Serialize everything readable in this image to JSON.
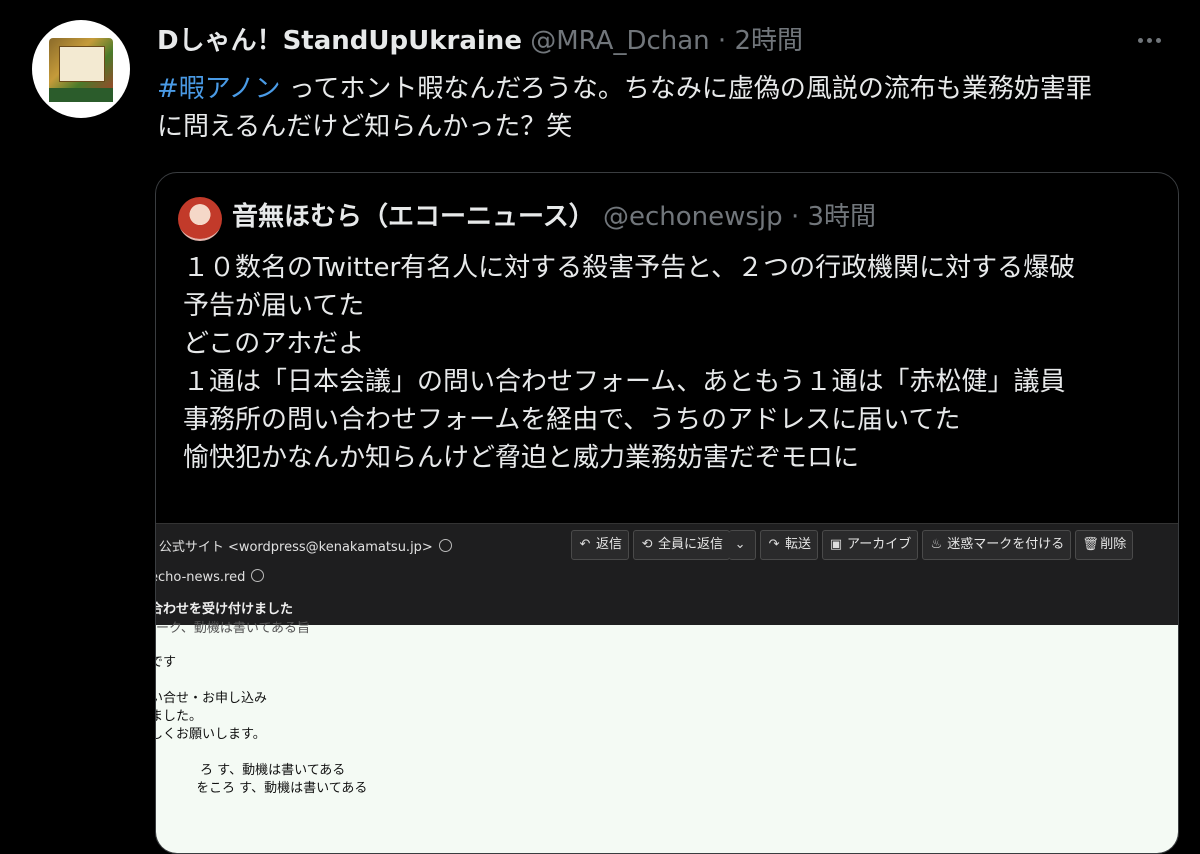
{
  "tweet": {
    "author_name": "Dしゃん！StandUpUkraine",
    "handle": "@MRA_Dchan",
    "separator": "·",
    "time": "2時間",
    "hashtag": "#暇アノン",
    "text_line1": " ってホント暇なんだろうな。ちなみに虚偽の風説の流布も業務妨害罪",
    "text_line2": "に問えるんだけど知らんかった？笑"
  },
  "quote": {
    "author_name": "音無ほむら（エコーニュース）",
    "handle": "@echonewsjp",
    "separator": "·",
    "time": "3時間",
    "lines": [
      "１０数名のTwitter有名人に対する殺害予告と、２つの行政機関に対する爆破",
      "予告が届いてた",
      "どこのアホだよ",
      "１通は「日本会議」の問い合わせフォーム、あともう１通は「赤松健」議員",
      "事務所の問い合わせフォームを経由で、うちのアドレスに届いてた",
      "愉快犯かなんか知らんけど脅迫と威力業務妨害だぞモロに"
    ]
  },
  "email": {
    "sender": "- 公式サイト <wordpress@kenakamatsu.jp>",
    "to": "echo-news.red",
    "subject": "合わせを受け付けました",
    "buttons": {
      "reply": "返信",
      "reply_all": "全員に返信",
      "forward": "転送",
      "archive": "アーカイブ",
      "spam": "迷惑マークを付ける",
      "delete": "削除"
    },
    "body_lines": [
      "ーク、動機は書いてある旨",
      "です",
      "い合せ・お申し込み",
      "ました。",
      "しくお願いします。",
      "ろ す、動機は書いてある",
      "をころ す、動機は書いてある"
    ]
  },
  "icons": {
    "more": "more-horizontal-icon",
    "reply": "reply-arrow-icon",
    "reply_all": "reply-all-icon",
    "forward": "forward-arrow-icon",
    "archive": "archive-box-icon",
    "spam": "flame-icon",
    "delete": "trash-icon"
  },
  "colors": {
    "background": "#000000",
    "text": "#e7e9ea",
    "muted": "#71767b",
    "hashtag": "#4a9be6"
  }
}
